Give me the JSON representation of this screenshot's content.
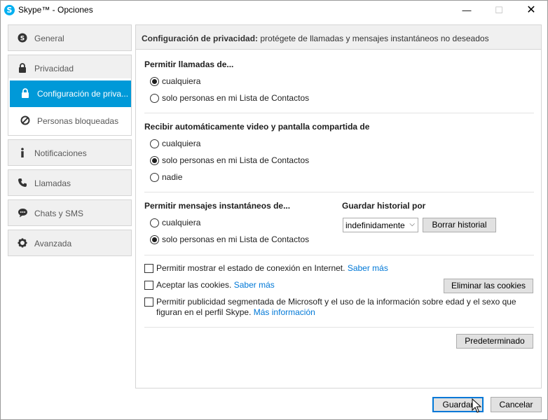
{
  "window": {
    "title": "Skype™ - Opciones",
    "logo_letter": "S",
    "minimize": "—",
    "maximize": "☐",
    "close": "✕"
  },
  "sidebar": {
    "items": [
      {
        "label": "General",
        "icon": "skype-icon"
      },
      {
        "label": "Privacidad",
        "icon": "lock-icon"
      },
      {
        "label": "Notificaciones",
        "icon": "info-icon"
      },
      {
        "label": "Llamadas",
        "icon": "phone-icon"
      },
      {
        "label": "Chats y SMS",
        "icon": "chat-icon"
      },
      {
        "label": "Avanzada",
        "icon": "gear-icon"
      }
    ],
    "subitems": [
      {
        "label": "Configuración de priva...",
        "icon": "lock-icon",
        "active": true
      },
      {
        "label": "Personas bloqueadas",
        "icon": "block-icon",
        "active": false
      }
    ],
    "active_color": "#0099d8"
  },
  "header": {
    "bold": "Configuración de privacidad:",
    "rest": " protégete de llamadas y mensajes instantáneos no deseados"
  },
  "calls": {
    "title": "Permitir llamadas de...",
    "options": [
      {
        "label": "cualquiera",
        "selected": true
      },
      {
        "label": "solo personas en mi Lista de Contactos",
        "selected": false
      }
    ]
  },
  "video": {
    "title": "Recibir automáticamente video y pantalla compartida de",
    "options": [
      {
        "label": "cualquiera",
        "selected": false
      },
      {
        "label": "solo personas en mi Lista de Contactos",
        "selected": true
      },
      {
        "label": "nadie",
        "selected": false
      }
    ]
  },
  "messages": {
    "title": "Permitir mensajes instantáneos de...",
    "options": [
      {
        "label": "cualquiera",
        "selected": false
      },
      {
        "label": "solo personas en mi Lista de Contactos",
        "selected": true
      }
    ]
  },
  "history": {
    "title": "Guardar historial por",
    "select_value": "indefinidamente",
    "clear_button": "Borrar historial"
  },
  "checks": {
    "online_status": {
      "label": "Permitir mostrar el estado de conexión en Internet.",
      "link": "Saber más",
      "checked": false
    },
    "cookies": {
      "label": "Aceptar las cookies.",
      "link": "Saber más",
      "checked": false
    },
    "ads": {
      "label": "Permitir publicidad segmentada de Microsoft y el uso de la información sobre edad y el sexo que figuran en el perfil Skype.",
      "link": "Más información",
      "checked": false
    }
  },
  "buttons": {
    "delete_cookies": "Eliminar las cookies",
    "default": "Predeterminado",
    "save": "Guardar",
    "cancel": "Cancelar"
  }
}
